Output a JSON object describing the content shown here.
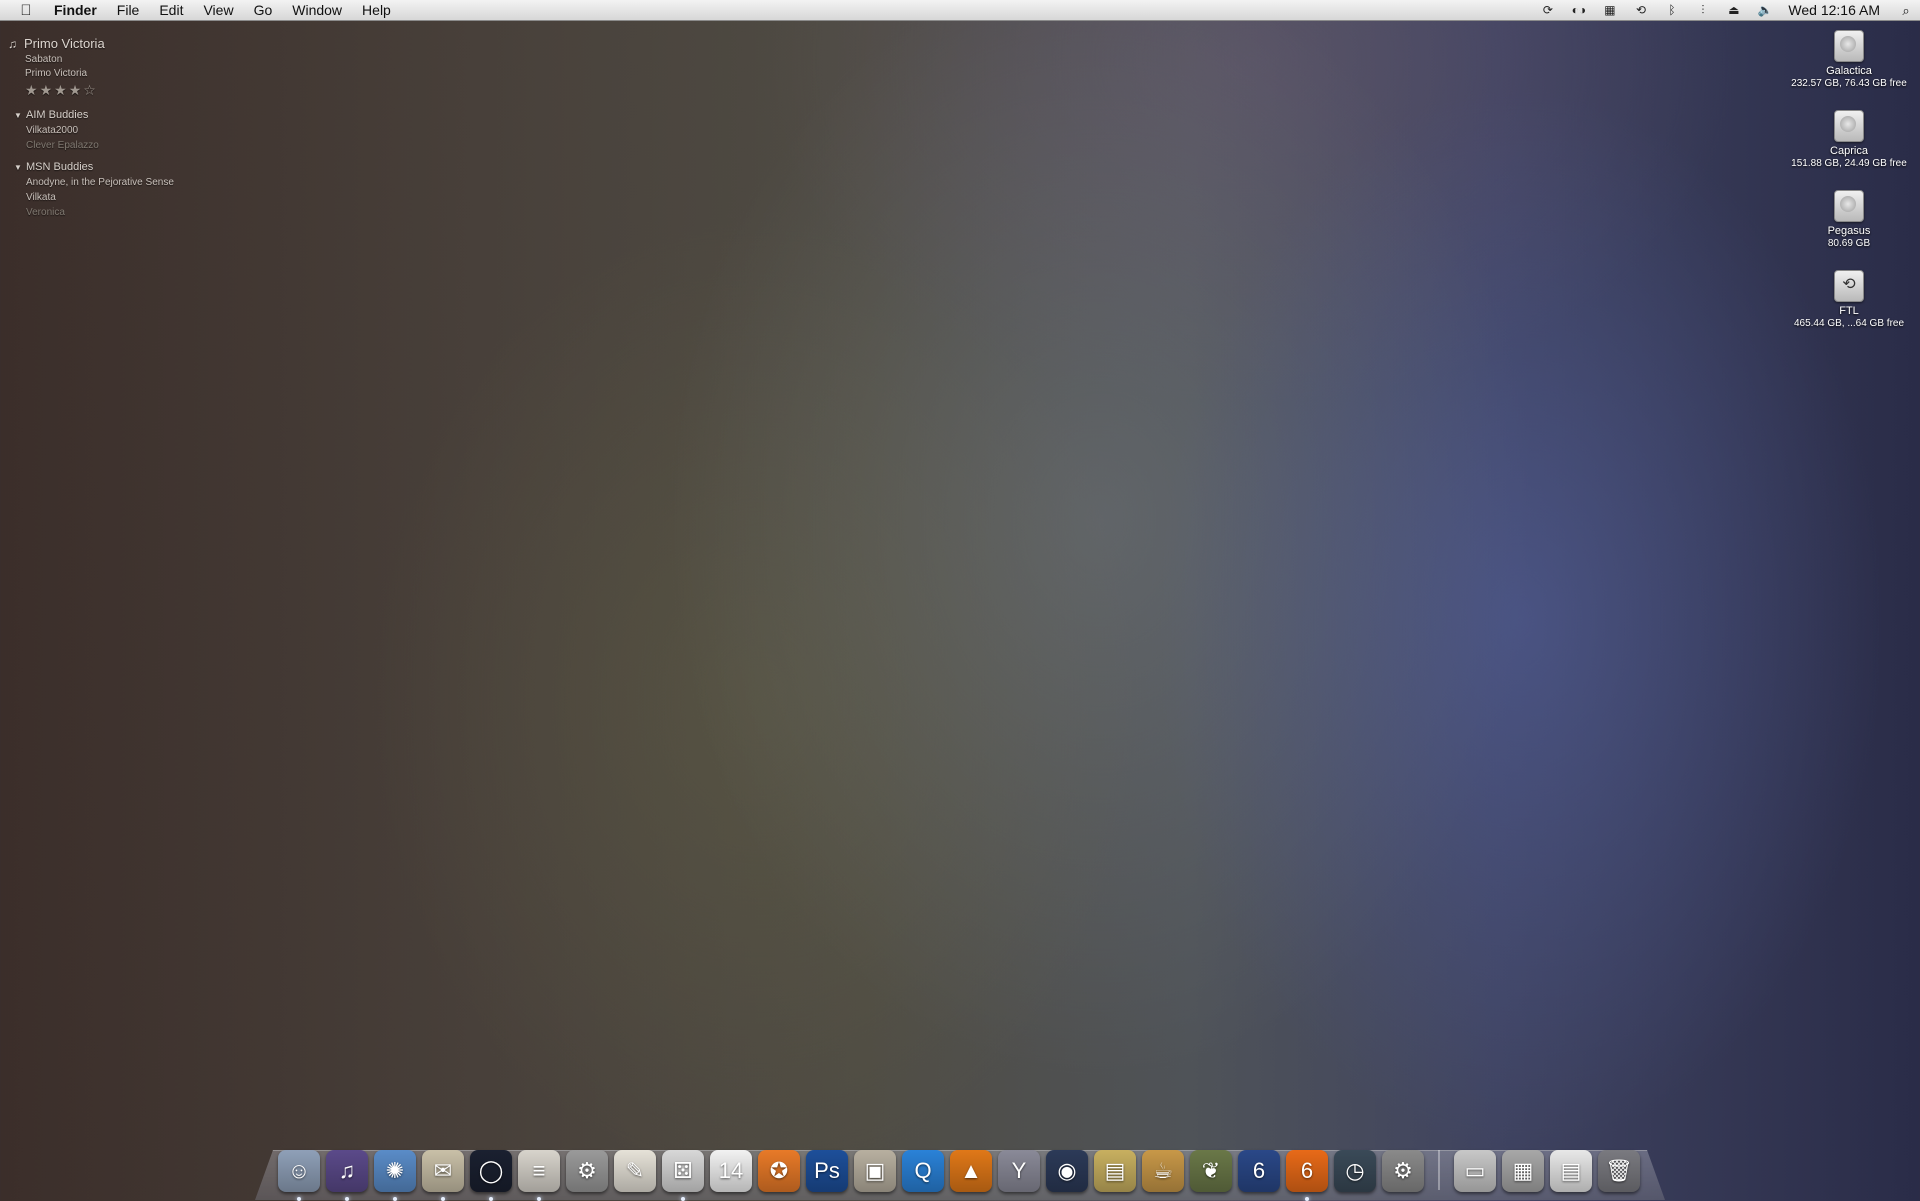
{
  "menubar": {
    "apple_icon": "apple-icon",
    "app_name": "Finder",
    "menus": [
      "File",
      "Edit",
      "View",
      "Go",
      "Window",
      "Help"
    ],
    "status_icons": [
      "sync-icon",
      "bluetooth-glasses-icon",
      "spaces-icon",
      "time-machine-icon",
      "bluetooth-icon",
      "wifi-icon",
      "eject-icon",
      "volume-icon"
    ],
    "clock": "Wed 12:16 AM",
    "spotlight_icon": "spotlight-icon"
  },
  "widget": {
    "now_playing": {
      "track": "Primo Victoria",
      "artist": "Sabaton",
      "album": "Primo Victoria",
      "rating": 4,
      "rating_max": 5
    },
    "groups": [
      {
        "name": "AIM Buddies",
        "buddies": [
          {
            "name": "Vilkata2000",
            "idle": false
          },
          {
            "name": "Clever Epalazzo",
            "idle": true
          }
        ]
      },
      {
        "name": "MSN Buddies",
        "buddies": [
          {
            "name": "Anodyne, in the Pejorative Sense",
            "idle": false
          },
          {
            "name": "Vilkata",
            "idle": false
          },
          {
            "name": "Veronica",
            "idle": true
          }
        ]
      }
    ]
  },
  "drives": [
    {
      "name": "Galactica",
      "info": "232.57 GB, 76.43 GB free",
      "icon": "hard-drive-icon"
    },
    {
      "name": "Caprica",
      "info": "151.88 GB, 24.49 GB free",
      "icon": "hard-drive-icon"
    },
    {
      "name": "Pegasus",
      "info": "80.69 GB",
      "icon": "hard-drive-icon"
    },
    {
      "name": "FTL",
      "info": "465.44 GB, ...64 GB free",
      "icon": "time-machine-drive-icon"
    }
  ],
  "dock": {
    "apps": [
      {
        "icon": "finder-icon",
        "color": "#8fa0b8",
        "glyph": "☺",
        "running": true
      },
      {
        "icon": "itunes-icon",
        "color": "#5b4a8a",
        "glyph": "♫",
        "running": true
      },
      {
        "icon": "safari-icon",
        "color": "#5a8cc8",
        "glyph": "✺",
        "running": true
      },
      {
        "icon": "mail-icon",
        "color": "#c9c0a8",
        "glyph": "✉",
        "running": true
      },
      {
        "icon": "chat-icon",
        "color": "#1a2030",
        "glyph": "◯",
        "running": true
      },
      {
        "icon": "newspaper-icon",
        "color": "#d8d4cc",
        "glyph": "≡",
        "running": true
      },
      {
        "icon": "settings-gear-icon",
        "color": "#9a9a9a",
        "glyph": "⚙",
        "running": false
      },
      {
        "icon": "textedit-icon",
        "color": "#e6e2d8",
        "glyph": "✎",
        "running": false
      },
      {
        "icon": "dice-icon",
        "color": "#d8d8d8",
        "glyph": "⚄",
        "running": true
      },
      {
        "icon": "calendar-icon",
        "color": "#f2f2f2",
        "glyph": "14",
        "running": false
      },
      {
        "icon": "piggy-bank-icon",
        "color": "#e87a28",
        "glyph": "✪",
        "running": false
      },
      {
        "icon": "photoshop-icon",
        "color": "#1d4f9a",
        "glyph": "Ps",
        "running": false
      },
      {
        "icon": "photo-viewer-icon",
        "color": "#b8b0a0",
        "glyph": "▣",
        "running": false
      },
      {
        "icon": "quicktime-icon",
        "color": "#2a82d8",
        "glyph": "Q",
        "running": false
      },
      {
        "icon": "vlc-icon",
        "color": "#e07818",
        "glyph": "▲",
        "running": false
      },
      {
        "icon": "cocktail-icon",
        "color": "#8a8a98",
        "glyph": "Y",
        "running": false
      },
      {
        "icon": "disk-burner-icon",
        "color": "#2c3a58",
        "glyph": "◉",
        "running": false
      },
      {
        "icon": "delivery-truck-icon",
        "color": "#c8b060",
        "glyph": "▤",
        "running": false
      },
      {
        "icon": "coffee-cup-icon",
        "color": "#c89848",
        "glyph": "☕",
        "running": false
      },
      {
        "icon": "leaf-icon",
        "color": "#6a7848",
        "glyph": "❦",
        "running": false
      },
      {
        "icon": "book-icon",
        "color": "#2a4888",
        "glyph": "6",
        "running": false
      },
      {
        "icon": "fire-app-icon",
        "color": "#e86a18",
        "glyph": "6",
        "running": true
      },
      {
        "icon": "time-machine-icon",
        "color": "#3a4a58",
        "glyph": "◷",
        "running": false
      },
      {
        "icon": "system-preferences-icon",
        "color": "#8a8a8a",
        "glyph": "⚙",
        "running": false
      }
    ],
    "stacks": [
      {
        "icon": "screenshot-stack-icon",
        "color": "#c8c8c8",
        "glyph": "▭"
      },
      {
        "icon": "picture-stack-icon",
        "color": "#a8a8a8",
        "glyph": "▦"
      },
      {
        "icon": "document-stack-icon",
        "color": "#e8e8e8",
        "glyph": "▤"
      },
      {
        "icon": "trash-icon",
        "color": "#7a7a80",
        "glyph": "🗑"
      }
    ]
  }
}
